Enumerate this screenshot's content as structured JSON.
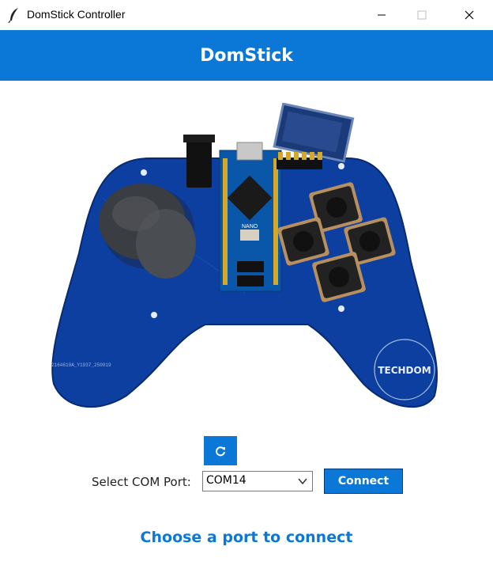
{
  "window": {
    "title": "DomStick Controller",
    "icons": {
      "app": "feather-icon",
      "minimize": "minimize-icon",
      "maximize": "maximize-icon",
      "close": "close-icon"
    }
  },
  "header": {
    "title": "DomStick"
  },
  "image": {
    "icon": "gamepad-illustration",
    "logo_text": "TECHDOM",
    "board_label": "NANO",
    "serial_text": "2164619A_Y1937_250919"
  },
  "controls": {
    "refresh_icon": "refresh-icon",
    "port_label": "Select COM Port:",
    "port_value": "COM14",
    "connect_label": "Connect"
  },
  "status": {
    "message": "Choose a port to connect"
  },
  "colors": {
    "accent": "#0b77d6",
    "board": "#0d3fa0"
  }
}
